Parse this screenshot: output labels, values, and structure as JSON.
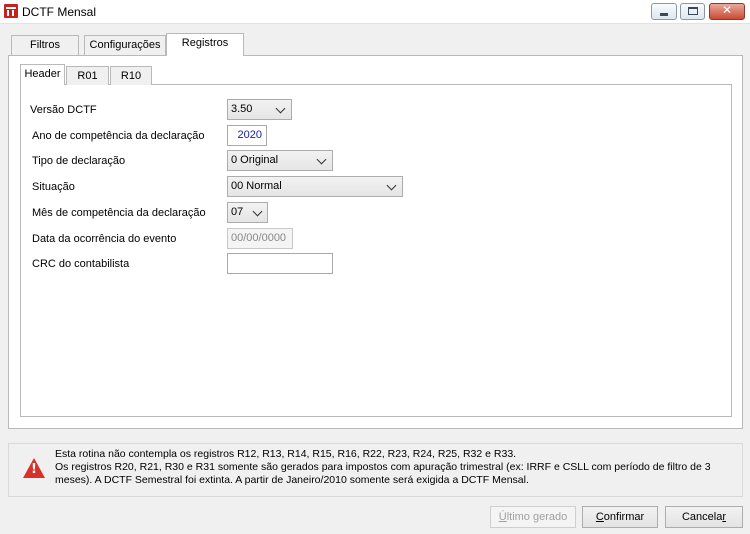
{
  "window": {
    "title": "DCTF Mensal"
  },
  "tabs": [
    "Filtros",
    "Configurações",
    "Registros"
  ],
  "subtabs": [
    "Header",
    "R01",
    "R10"
  ],
  "form": {
    "versao": {
      "label": "Versão DCTF",
      "value": "3.50"
    },
    "ano": {
      "label": "Ano de competência da declaração",
      "value": "2020"
    },
    "tipo": {
      "label": "Tipo de declaração",
      "value": "0 Original"
    },
    "situacao": {
      "label": "Situação",
      "value": "00 Normal"
    },
    "mes": {
      "label": "Mês de competência da declaração",
      "value": "07"
    },
    "data_evento": {
      "label": "Data da ocorrência do evento",
      "placeholder": "00/00/0000"
    },
    "crc": {
      "label": "CRC do contabilista",
      "value": ""
    }
  },
  "info": {
    "icon": "warning-icon",
    "lines": [
      "Esta rotina não contempla os registros R12, R13, R14, R15, R16, R22, R23, R24, R25, R32 e R33.",
      "Os registros R20, R21, R30 e R31 somente são gerados para impostos com apuração trimestral (ex: IRRF e CSLL com período de filtro de 3",
      "meses). A DCTF Semestral foi extinta. A partir de Janeiro/2010 somente será exigida a DCTF Mensal."
    ]
  },
  "buttons": {
    "ultimo": {
      "first": "Ú",
      "rest": "ltimo gerado"
    },
    "confirmar": {
      "first": "C",
      "rest": "onfirmar"
    },
    "cancelar": {
      "main": "Cancela",
      "last": "r"
    }
  },
  "colors": {
    "accent_value": "#1a1aa6",
    "warning": "#d7312a"
  }
}
